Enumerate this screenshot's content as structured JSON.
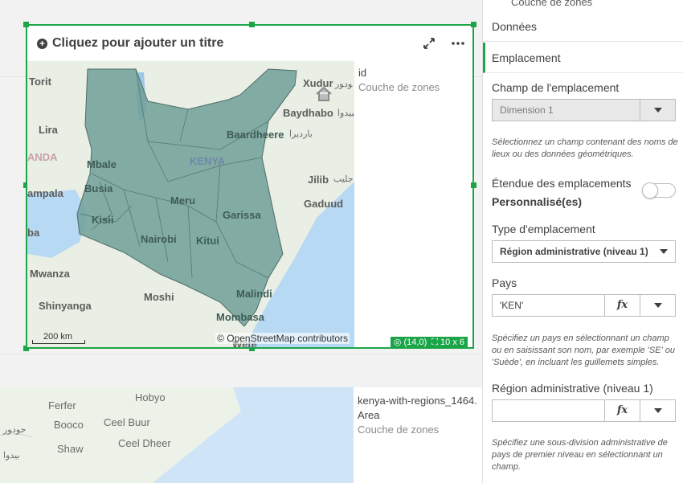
{
  "map_object": {
    "title_placeholder": "Cliquez pour ajouter un titre",
    "legend_field": "id",
    "legend_layer": "Couche de zones",
    "attribution": "© OpenStreetMap contributors",
    "scale": "200 km",
    "status_position": "(14,0)",
    "status_size": "10 x 6",
    "labels": [
      "Torit",
      "Xudur",
      "Baydhabo",
      "Lira",
      "Baardheere",
      "KENYA",
      "Mbale",
      "Jilib",
      "Busia",
      "Meru",
      "Gaduud",
      "ampala",
      "Kisii",
      "Garissa",
      "Nairobi",
      "Kitui",
      "Mwanza",
      "Malindi",
      "Shinyanga",
      "Moshi",
      "Mombasa",
      "ANDA",
      "Wete",
      "ba"
    ],
    "labels_arabic": [
      "ﻮﺩﻮﺭ",
      "ﺒﻴﺪﻭﺍ",
      "ﺑﺎﺭﺩﻳﺮﺍ",
      "ﺟﻠﻴﺐ"
    ]
  },
  "map_object_2": {
    "legend_field": "kenya-with-regions_1464.Area",
    "legend_layer": "Couche de zones",
    "labels": [
      "Ferfer",
      "Hobyo",
      "Booco",
      "Ceel Buur",
      "Shaw",
      "Ceel Dheer"
    ],
    "labels_arabic": [
      "ﺣﻮﺩﻮﺭ",
      "ﺑﻴﺪﻭﺍ"
    ]
  },
  "panel": {
    "top_cut_label": "Couche de zones",
    "section_data": "Données",
    "section_location": "Emplacement",
    "location_field_label": "Champ de l'emplacement",
    "location_field_value": "Dimension 1",
    "location_field_help": "Sélectionnez un champ contenant des noms de lieux ou des données géométriques.",
    "scope_label": "Étendue des emplacements",
    "scope_value": "Personnalisé(es)",
    "type_label": "Type d'emplacement",
    "type_value": "Région administrative (niveau 1)",
    "country_label": "Pays",
    "country_value": "'KEN'",
    "country_help": "Spécifiez un pays en sélectionnant un champ ou en saisissant son nom, par exemple 'SE' ou 'Suède', en incluant les guillemets simples.",
    "region_label": "Région administrative (niveau 1)",
    "region_value": "",
    "region_help": "Spécifiez une sous-division administrative de pays de premier niveau en sélectionnant un champ.",
    "fx": "fx"
  },
  "colors": {
    "accent": "#1ca548",
    "region_fill": "#6e9f98",
    "water": "#b8d9f3"
  }
}
